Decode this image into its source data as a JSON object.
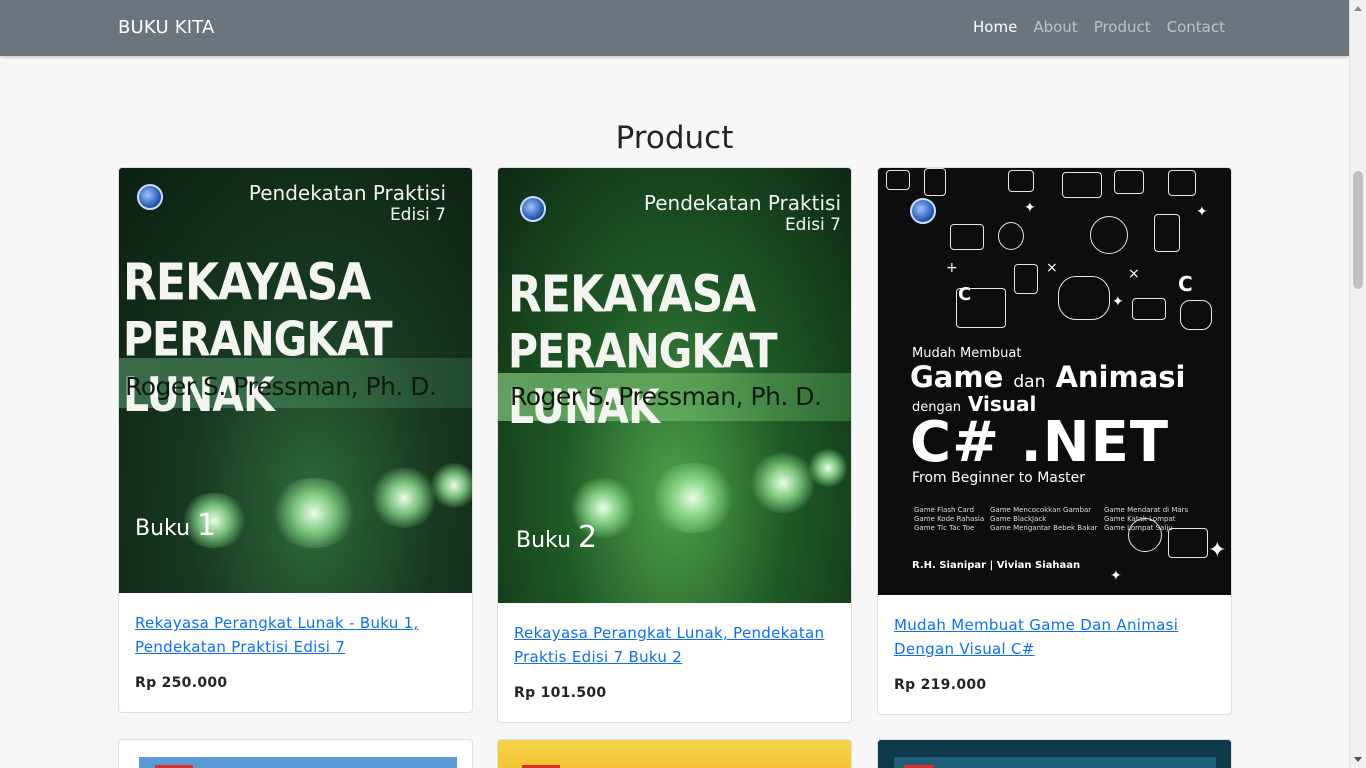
{
  "navbar": {
    "brand": "BUKU KITA",
    "links": [
      {
        "label": "Home",
        "active": true
      },
      {
        "label": "About",
        "active": false
      },
      {
        "label": "Product",
        "active": false
      },
      {
        "label": "Contact",
        "active": false
      }
    ]
  },
  "section": {
    "title": "Product"
  },
  "products": [
    {
      "title": "Rekayasa Perangkat Lunak - Buku 1, Pendekatan Praktisi Edisi 7",
      "price": "Rp 250.000",
      "cover": {
        "subtitle_line1": "Pendekatan Praktisi",
        "subtitle_line2": "Edisi 7",
        "title_line1": "REKAYASA",
        "title_line2": "PERANGKAT LUNAK",
        "author": "Roger S. Pressman, Ph. D.",
        "book_word": "Buku",
        "book_number": "1"
      }
    },
    {
      "title": "Rekayasa Perangkat Lunak, Pendekatan Praktis Edisi 7 Buku 2",
      "price": "Rp 101.500",
      "cover": {
        "subtitle_line1": "Pendekatan Praktisi",
        "subtitle_line2": "Edisi 7",
        "title_line1": "REKAYASA",
        "title_line2": "PERANGKAT LUNAK",
        "author": "Roger S. Pressman, Ph. D.",
        "book_word": "Buku",
        "book_number": "2"
      }
    },
    {
      "title": "Mudah Membuat Game Dan Animasi Dengan Visual C#",
      "price": "Rp 219.000",
      "cover": {
        "line1": "Mudah Membuat",
        "line2_a": "Game",
        "line2_b": "dan",
        "line2_c": "Animasi",
        "line3_a": "dengan",
        "line3_b": "Visual",
        "line4": "C# .NET",
        "line5": "From Beginner to Master",
        "bullets": [
          "Game Flash Card",
          "Game Mencocokkan Gambar",
          "Game Mendarat di Mars",
          "Game Kode Rahasia",
          "Game BlackJack",
          "Game Katak Lompat",
          "Game Tic Tac Toe",
          "Game Mengantar Bebek Bakar",
          "Game Lompat Salju"
        ],
        "authors": "R.H. Sianipar  |  Vivian Siahaan"
      }
    }
  ],
  "colors": {
    "navbar": "#6c757d",
    "link": "#0d6efd",
    "page_bg": "#f7f7f8"
  },
  "icons": [
    "scroll-up-arrow-icon",
    "scroll-down-arrow-icon",
    "publisher-logo-icon"
  ]
}
